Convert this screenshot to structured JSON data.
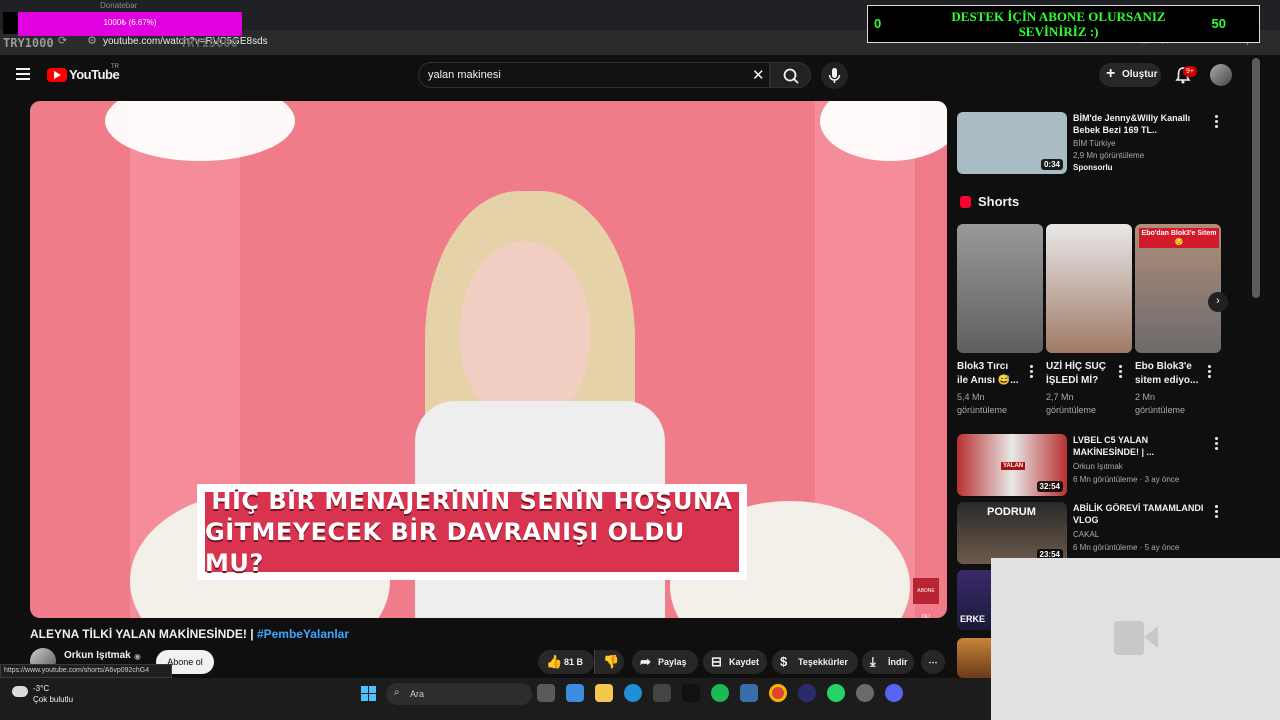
{
  "browser": {
    "donate_label": "Donatebar",
    "progress_label": "1000₺ (6.67%)",
    "try_left": "TRY1000",
    "try_mid": "TRY15000",
    "url": "youtube.com/watch?v=RVC5GE8sds"
  },
  "stream_widget": {
    "left_count": "0",
    "message_line1": "DESTEK İÇİN ABONE OLURSANIZ",
    "message_line2": "SEVİNİRİZ :)",
    "right_count": "50"
  },
  "youtube": {
    "logo_text": "YouTube",
    "region": "TR",
    "search_value": "yalan makinesi",
    "create_label": "Oluştur",
    "notifications_badge": "9+"
  },
  "video": {
    "subtitle_line1": "HİÇ BİR MENAJERİNİN SENİN HOŞUNA",
    "subtitle_line2": "GİTMEYECEK BİR DAVRANIŞI OLDU MU?",
    "abone_badge": "ABONE OL!",
    "title_main": "ALEYNA TİLKİ YALAN MAKİNESİNDE! | ",
    "title_hashtag": "#PembeYalanlar",
    "channel": "Orkun Işıtmak",
    "subscribe_label": "Abone ol",
    "likes": "81 B",
    "share_label": "Paylaş",
    "save_label": "Kaydet",
    "thanks_label": "Teşekkürler",
    "download_label": "İndir",
    "status_url": "https://www.youtube.com/shorts/A6vp092chG4"
  },
  "sidebar": {
    "ad": {
      "title_line1": "BİM'de Jenny&Willy Kanallı",
      "title_line2": "Bebek Bezi 169 TL..",
      "channel": "BİM Türkiye",
      "views": "2,9 Mn görüntüleme",
      "sponsored": "Sponsorlu",
      "duration": "0:34"
    },
    "shorts_label": "Shorts",
    "shorts": [
      {
        "title_line1": "Blok3 Tırcı",
        "title_line2": "ile Anısı 😅...",
        "views_line1": "5,4 Mn",
        "views_line2": "görüntüleme"
      },
      {
        "title_line1": "UZİ HİÇ SUÇ",
        "title_line2": "İŞLEDİ Mİ?",
        "views_line1": "2,7 Mn",
        "views_line2": "görüntüleme"
      },
      {
        "title_line1": "Ebo Blok3'e",
        "title_line2": "sitem ediyo...",
        "views_line1": "2 Mn",
        "views_line2": "görüntüleme",
        "thumb_text": "Ebo'dan Blok3'e Sitem 😔"
      }
    ],
    "videos": [
      {
        "title_line1": "LVBEL C5 YALAN",
        "title_line2": "MAKİNESİNDE! | ...",
        "channel": "Orkun Işıtmak",
        "meta": "6 Mn görüntüleme · 3 ay önce",
        "duration": "32:54",
        "thumb_text": "YALAN"
      },
      {
        "title_line1": "ABİLİK GÖREVİ TAMAMLANDI",
        "title_line2": "VLOG",
        "channel": "CAKAL",
        "meta": "6 Mn görüntüleme · 5 ay önce",
        "duration": "23:54",
        "thumb_text": "PODRUM"
      }
    ],
    "partial_thumb_text": "ERKE"
  },
  "taskbar": {
    "temperature": "-3°C",
    "weather": "Çok bulutlu",
    "search_label": "Ara"
  },
  "colors": {
    "accent_red": "#ff0000",
    "link_blue": "#3ea6ff",
    "overlay_magenta": "#e100e0",
    "widget_green": "#2fff2f",
    "video_pink": "#f07b89"
  }
}
